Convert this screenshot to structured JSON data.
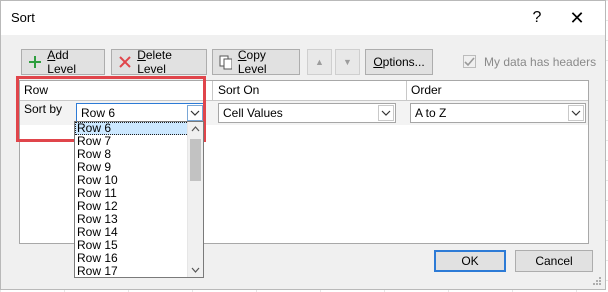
{
  "dialog": {
    "title": "Sort",
    "help_label": "?",
    "close_label": "✕"
  },
  "toolbar": {
    "add_level": {
      "underline": "A",
      "rest": "dd Level"
    },
    "delete_level": {
      "underline": "D",
      "rest": "elete Level"
    },
    "copy_level": {
      "underline": "C",
      "rest": "opy Level"
    },
    "move_up_label": "▲",
    "move_down_label": "▼",
    "options": {
      "underline": "O",
      "rest": "ptions..."
    },
    "my_data_headers_label": "My data has headers",
    "my_data_headers_checked": true
  },
  "grid": {
    "col_row": "Row",
    "col_sort_on": "Sort On",
    "col_order": "Order",
    "sort_by_label": "Sort by",
    "sort_by_value": "Row 6",
    "sort_on_value": "Cell Values",
    "order_value": "A to Z"
  },
  "dropdown": {
    "items": [
      "Row 6",
      "Row 7",
      "Row 8",
      "Row 9",
      "Row 10",
      "Row 11",
      "Row 12",
      "Row 13",
      "Row 14",
      "Row 15",
      "Row 16",
      "Row 17"
    ],
    "selected_index": 0
  },
  "footer": {
    "ok_label": "OK",
    "cancel_label": "Cancel"
  },
  "colors": {
    "highlight": "#e0454b",
    "accent": "#2d7bd6",
    "add_icon": "#2e9e3e",
    "delete_icon": "#e0454b"
  }
}
